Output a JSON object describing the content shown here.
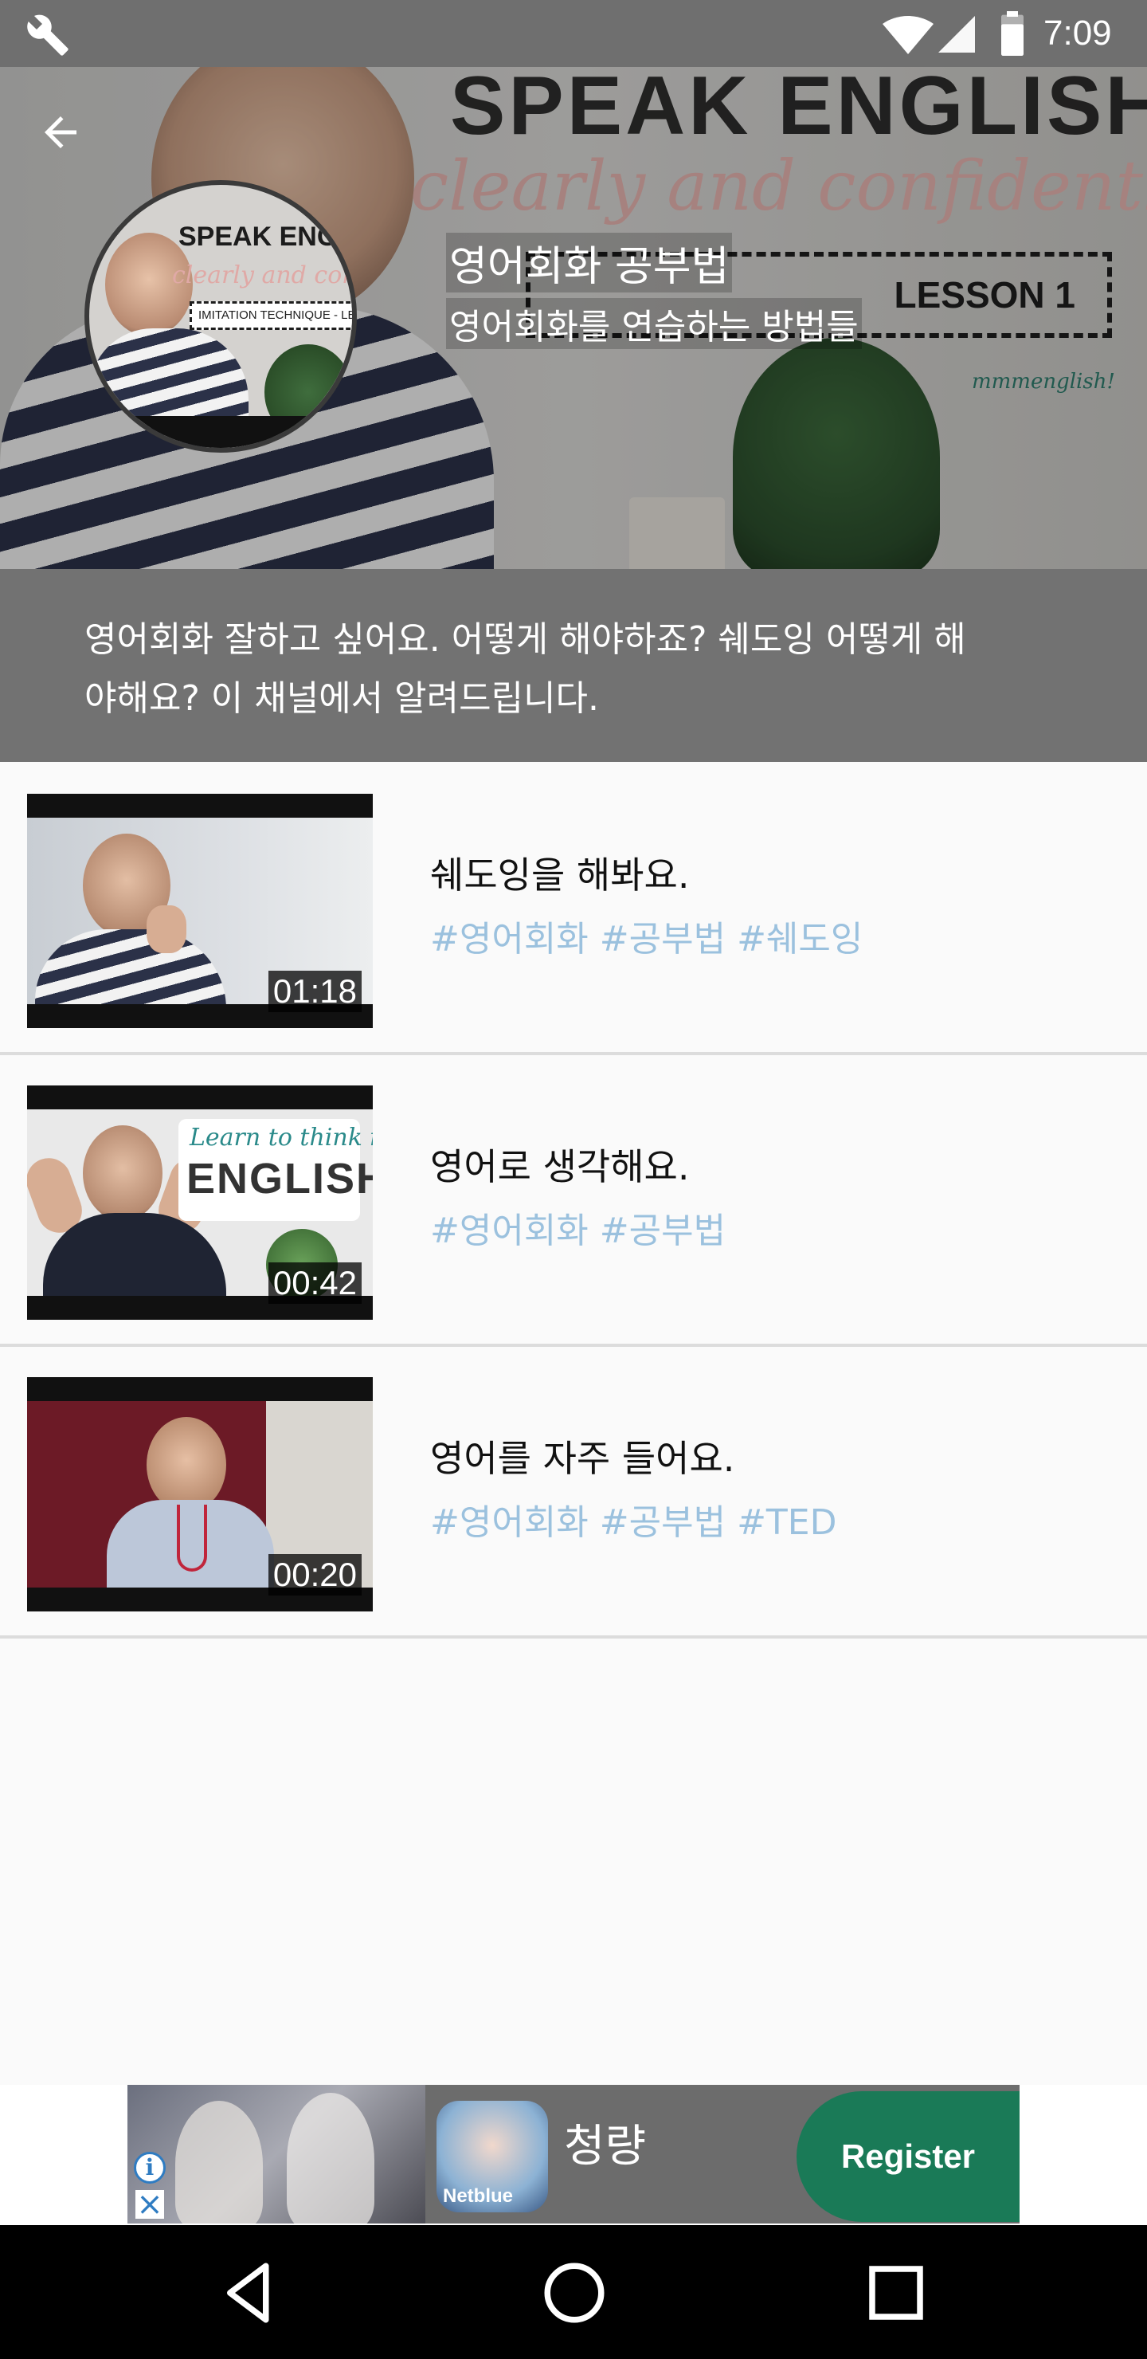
{
  "status_bar": {
    "time": "7:09"
  },
  "cover": {
    "banner_title": "SPEAK ENGLISH",
    "banner_script": "clearly and confidently",
    "banner_lesson": "LESSON 1",
    "brand": "mmmenglish!"
  },
  "avatar": {
    "title": "SPEAK ENGL",
    "script": "clearly and confi",
    "box_text": "IMITATION TECHNIQUE - LES"
  },
  "channel": {
    "title": "영어회화 공부법",
    "subtitle": "영어회화를 연습하는 방법들"
  },
  "description": {
    "line1": "영어회화 잘하고 싶어요. 어떻게 해야하죠? 쉐도잉 어떻게 해",
    "line2": "야해요? 이 채널에서 알려드립니다."
  },
  "videos": [
    {
      "title": "쉐도잉을 해봐요.",
      "tags": "#영어회화 #공부법 #쉐도잉",
      "duration": "01:18"
    },
    {
      "title": "영어로 생각해요.",
      "tags": "#영어회화 #공부법",
      "duration": "00:42",
      "thumb_text_1": "Learn to think in",
      "thumb_text_2": "ENGLISH"
    },
    {
      "title": "영어를 자주 들어요.",
      "tags": "#영어회화 #공부법 #TED",
      "duration": "00:20"
    }
  ],
  "ad": {
    "app_name": "청량",
    "logo_text": "Netblue",
    "cta": "Register"
  }
}
